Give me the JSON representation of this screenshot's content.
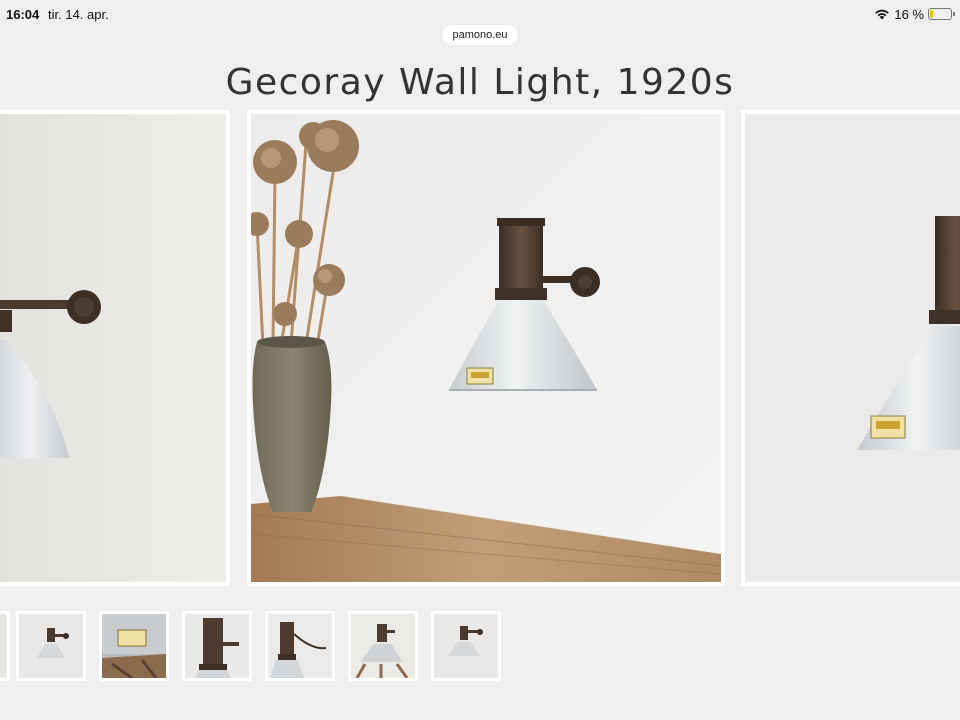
{
  "status_bar": {
    "time": "16:04",
    "date": "tir. 14. apr.",
    "battery": "16 %",
    "battery_level": 0.16
  },
  "browser": {
    "url": "pamono.eu"
  },
  "product": {
    "title": "Gecoray Wall Light, 1920s"
  },
  "gallery": {
    "images": [
      {
        "name": "side-view"
      },
      {
        "name": "main-view"
      },
      {
        "name": "front-view"
      }
    ],
    "thumbnails": [
      {
        "name": "thumb-1"
      },
      {
        "name": "thumb-2"
      },
      {
        "name": "thumb-3"
      },
      {
        "name": "thumb-4"
      },
      {
        "name": "thumb-5"
      },
      {
        "name": "thumb-6"
      },
      {
        "name": "thumb-7"
      }
    ]
  },
  "colors": {
    "background": "#efefef",
    "title": "#333333",
    "bronze": "#5a4232",
    "shade": "#d9dcdf"
  }
}
